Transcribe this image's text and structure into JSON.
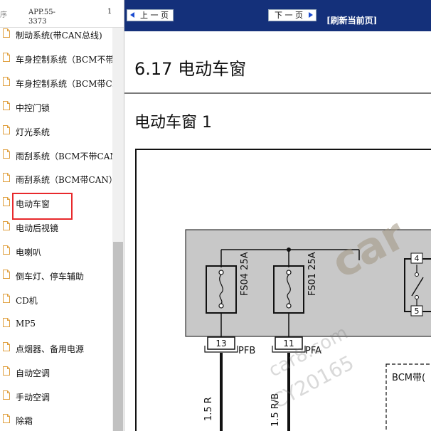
{
  "sidebar": {
    "header": {
      "col1": "序",
      "col2": "APP.55-3373",
      "col3": "1"
    },
    "items": [
      {
        "label": "制动系统(带CAN总线)"
      },
      {
        "label": "车身控制系统（BCM不带CAN）"
      },
      {
        "label": "车身控制系统（BCM带CAN）"
      },
      {
        "label": "中控门锁"
      },
      {
        "label": "灯光系统"
      },
      {
        "label": "雨刮系统（BCM不带CAN）"
      },
      {
        "label": "雨刮系统（BCM带CAN）"
      },
      {
        "label": "电动车窗",
        "selected": true
      },
      {
        "label": "电动后视镜"
      },
      {
        "label": "电喇叭"
      },
      {
        "label": "倒车灯、停车辅助"
      },
      {
        "label": "CD机"
      },
      {
        "label": "MP5"
      },
      {
        "label": "点烟器、备用电源"
      },
      {
        "label": "自动空调"
      },
      {
        "label": "手动空调"
      },
      {
        "label": "除霜"
      }
    ]
  },
  "viewer": {
    "nav": {
      "prev_label": "上 一 页",
      "next_label": "下 一 页",
      "refresh_label": "[刷新当前页]"
    },
    "section_title": "6.17 电动车窗",
    "diagram_title": "电动车窗 1",
    "diagram": {
      "fuse1_label": "FS04 25A",
      "fuse2_label": "FS01 25A",
      "connector1_pin": "13",
      "connector1_name": "PFB",
      "connector2_pin": "11",
      "connector2_name": "PFA",
      "wire1_label": "1.5 R",
      "wire2_label": "1.5 R/B",
      "relay_pin_top": "4",
      "relay_pin_bottom": "5",
      "module_label": "BCM带("
    },
    "watermark": {
      "logo": "car",
      "domain": "car8.com",
      "code": "CY20165"
    }
  },
  "colors": {
    "nav_bg": "#14307a",
    "selection_border": "#e8292c",
    "fuse_box_bg": "#c8c8c8",
    "doc_icon": "#e0a040"
  }
}
